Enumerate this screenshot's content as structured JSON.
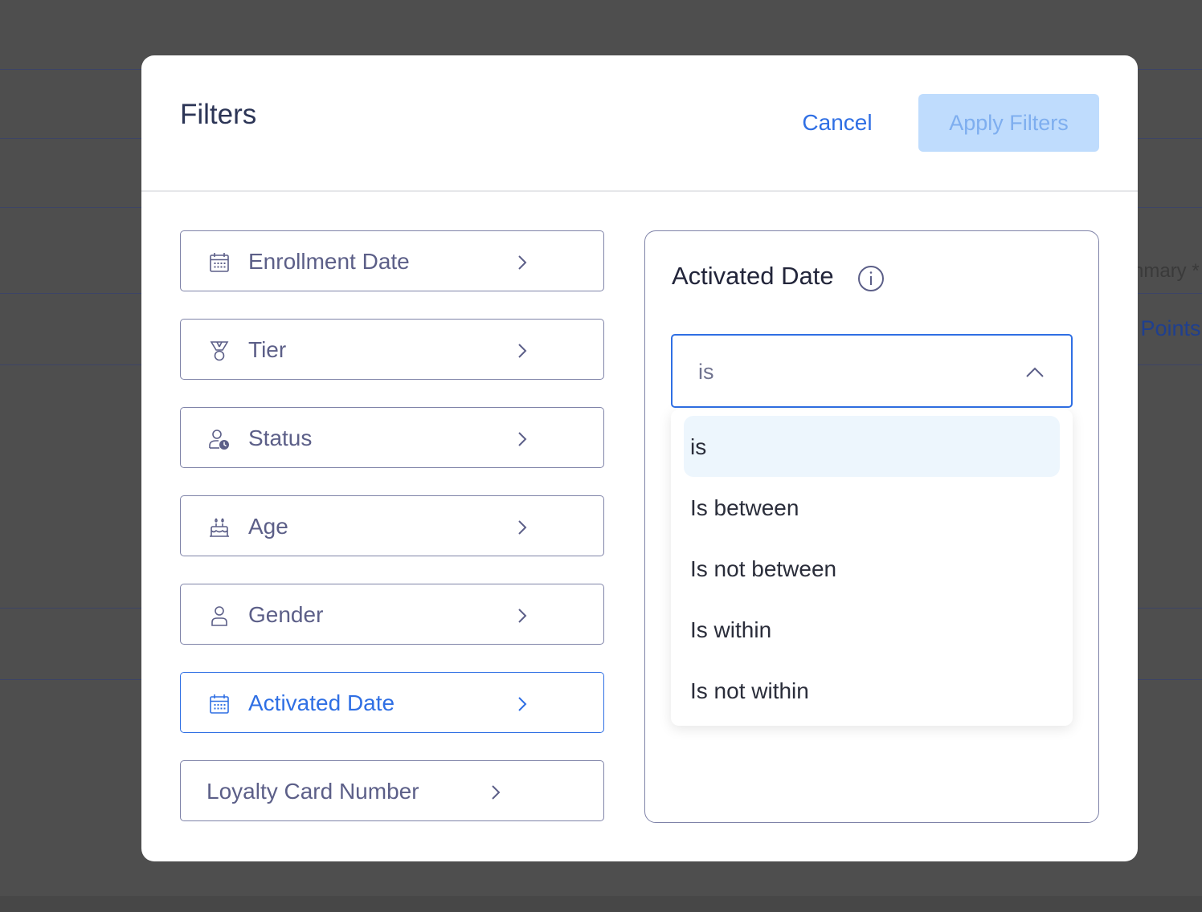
{
  "background": {
    "summary_text": "nmary *",
    "points_text": "l Points"
  },
  "modal": {
    "title": "Filters",
    "cancel_label": "Cancel",
    "apply_label": "Apply Filters"
  },
  "filters": [
    {
      "label": "Enrollment Date",
      "icon": "calendar-icon",
      "active": false
    },
    {
      "label": "Tier",
      "icon": "medal-icon",
      "active": false
    },
    {
      "label": "Status",
      "icon": "user-clock-icon",
      "active": false
    },
    {
      "label": "Age",
      "icon": "cake-icon",
      "active": false
    },
    {
      "label": "Gender",
      "icon": "person-icon",
      "active": false
    },
    {
      "label": "Activated Date",
      "icon": "calendar-icon",
      "active": true
    },
    {
      "label": "Loyalty Card Number",
      "icon": "",
      "active": false
    }
  ],
  "detail": {
    "title": "Activated Date",
    "select_value": "is",
    "options": [
      "is",
      "Is between",
      "Is not between",
      "Is within",
      "Is not within"
    ],
    "selected_option": "is"
  },
  "colors": {
    "accent": "#2f6fe4",
    "apply_bg": "#bfdcfd",
    "border": "#7f83a8",
    "option_highlight": "#edf6fd",
    "overlay": "#4e4e4e"
  }
}
